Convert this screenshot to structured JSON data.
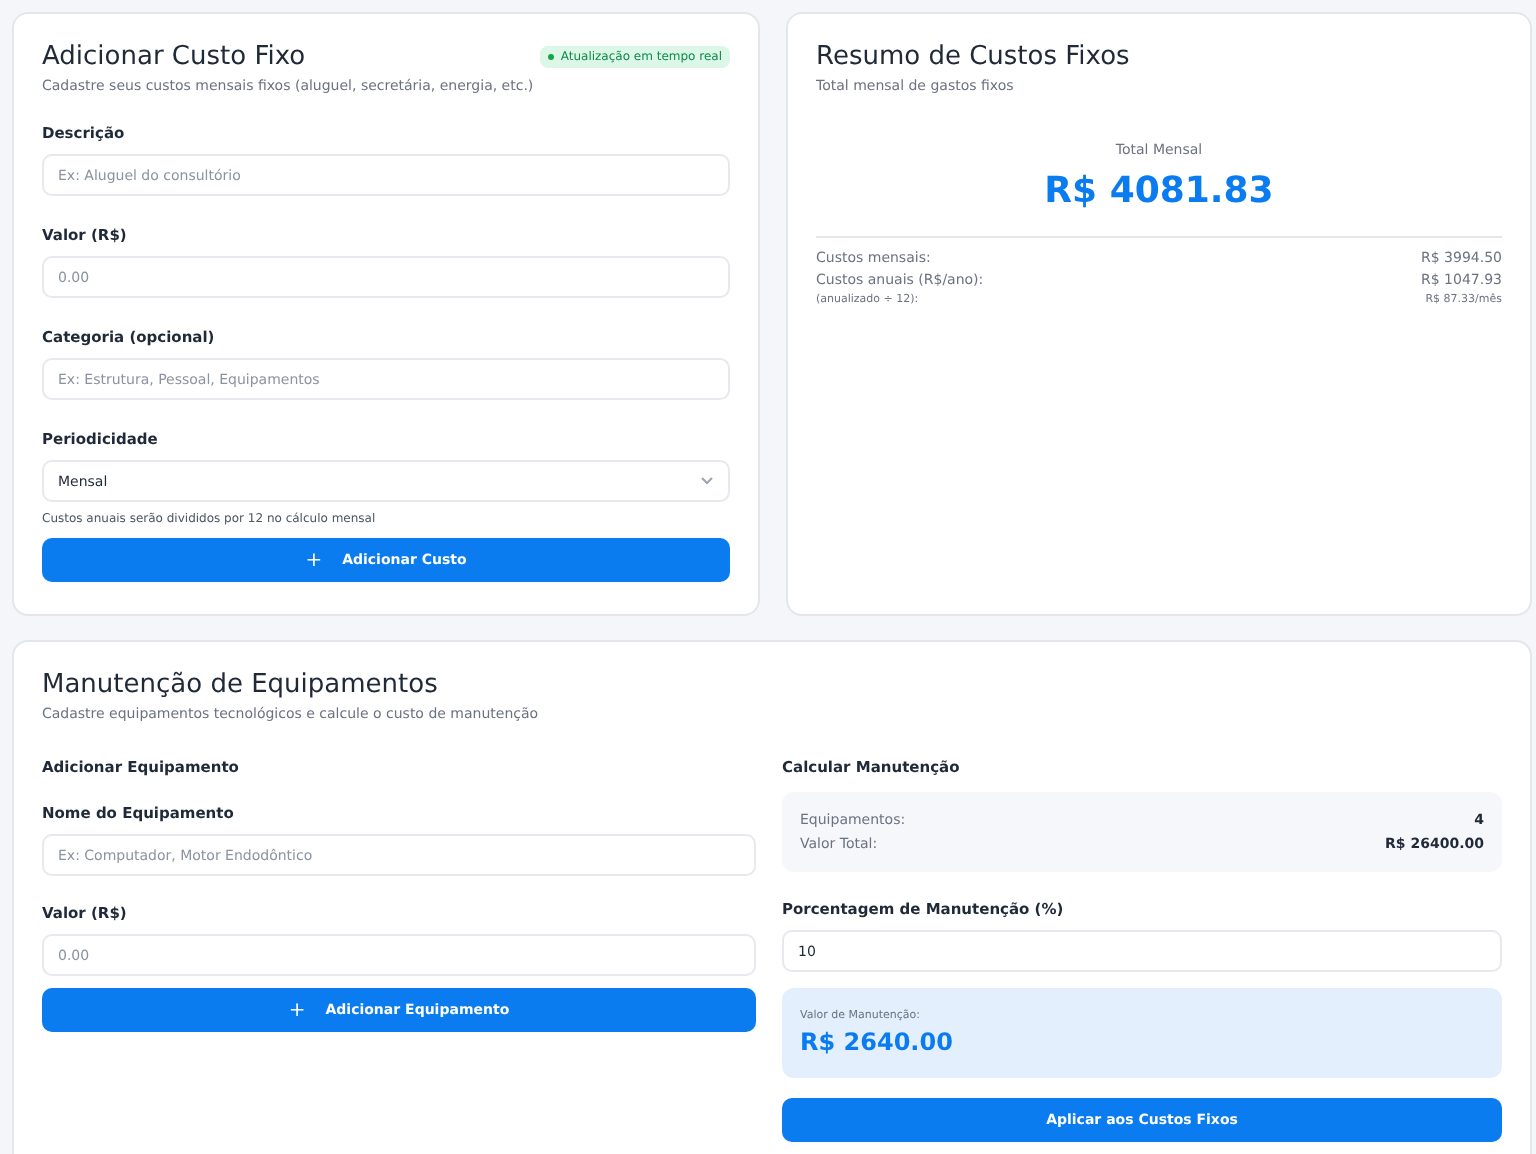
{
  "add_fixed_cost": {
    "title": "Adicionar Custo Fixo",
    "badge": "Atualização em tempo real",
    "subtitle": "Cadastre seus custos mensais fixos (aluguel, secretária, energia, etc.)",
    "fields": [
      {
        "kind": "text",
        "label": "Descrição",
        "placeholder": "Ex: Aluguel do consultório"
      },
      {
        "kind": "text",
        "label": "Valor (R$)",
        "placeholder": "0.00"
      },
      {
        "kind": "text",
        "label": "Categoria (opcional)",
        "placeholder": "Ex: Estrutura, Pessoal, Equipamentos"
      },
      {
        "kind": "select",
        "label": "Periodicidade",
        "value": "Mensal",
        "hint": "Custos anuais serão divididos por 12 no cálculo mensal"
      }
    ],
    "button": {
      "icon": "+",
      "label": "Adicionar Custo"
    }
  },
  "summary": {
    "title": "Resumo de Custos Fixos",
    "subtitle": "Total mensal de gastos fixos",
    "total_label": "Total Mensal",
    "total": "R$ 4081.83",
    "rows": [
      {
        "kind": "normal",
        "label": "Custos mensais:",
        "value": "R$ 3994.50"
      },
      {
        "kind": "normal",
        "label": "Custos anuais (R$/ano):",
        "value": "R$ 1047.93"
      },
      {
        "kind": "small",
        "label": "(anualizado ÷ 12):",
        "value": "R$ 87.33/mês"
      }
    ]
  },
  "maintenance": {
    "title": "Manutenção de Equipamentos",
    "subtitle": "Cadastre equipamentos tecnológicos e calcule o custo de manutenção",
    "add": {
      "heading": "Adicionar Equipamento",
      "fields": [
        {
          "label": "Nome do Equipamento",
          "placeholder": "Ex: Computador, Motor Endodôntico"
        },
        {
          "label": "Valor (R$)",
          "placeholder": "0.00"
        }
      ],
      "button": {
        "icon": "+",
        "label": "Adicionar Equipamento"
      }
    },
    "calc": {
      "heading": "Calcular Manutenção",
      "stats": [
        {
          "label": "Equipamentos:",
          "value": "4"
        },
        {
          "label": "Valor Total:",
          "value": "R$ 26400.00"
        }
      ],
      "percent_label": "Porcentagem de Manutenção (%)",
      "percent_value": "10",
      "result_label": "Valor de Manutenção:",
      "result": "R$ 2640.00",
      "button": "Aplicar aos Custos Fixos"
    }
  }
}
